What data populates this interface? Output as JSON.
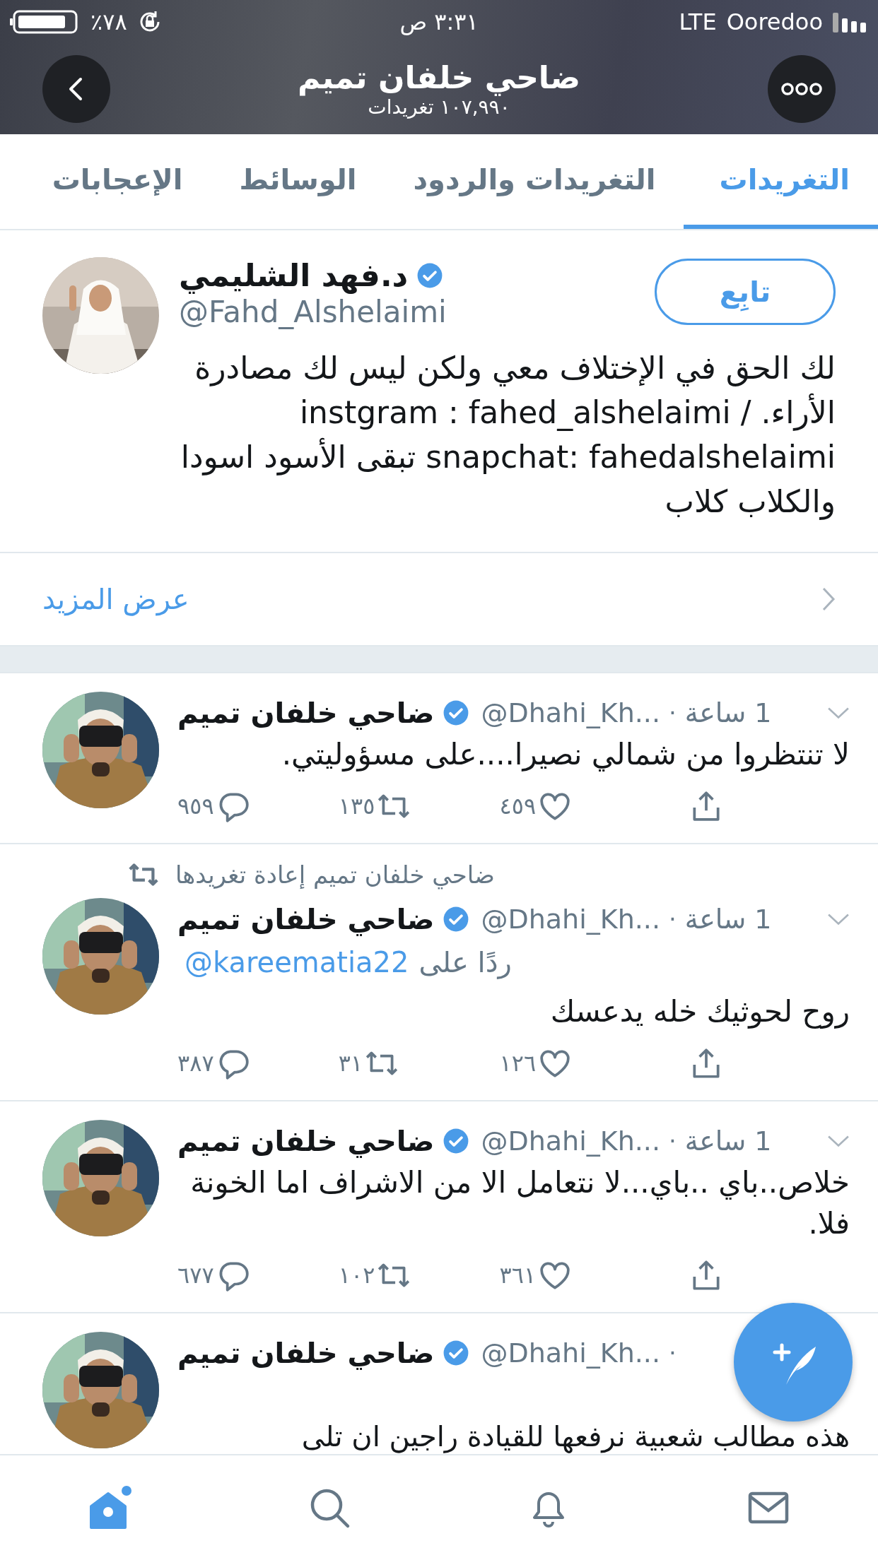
{
  "status_bar": {
    "battery": "٪٧٨",
    "time": "٣:٣١ ص",
    "network": "LTE",
    "carrier": "Ooredoo"
  },
  "header": {
    "title": "ضاحي خلفان تميم",
    "subtitle": "١٠٧,٩٩٠ تغريدات"
  },
  "tabs": [
    {
      "label": "التغريدات",
      "selected": true
    },
    {
      "label": "التغريدات والردود",
      "selected": false
    },
    {
      "label": "الوسائط",
      "selected": false
    },
    {
      "label": "الإعجابات",
      "selected": false
    }
  ],
  "profile_card": {
    "name": "د.فهد الشليمي",
    "verified": true,
    "handle": "@Fahd_Alshelaimi",
    "follow_button": "تابِع",
    "bio": "لك الحق في الإختلاف معي ولكن ليس لك مصادرة الأراء. / instgram : fahed_alshelaimi snapchat: fahedalshelaimi تبقى الأسود اسودا والكلاب كلاب"
  },
  "show_more": "عرض المزيد",
  "tweets": [
    {
      "name": "ضاحي خلفان تميم",
      "verified": true,
      "handle": "@Dhahi_Kh...",
      "sep": "·",
      "time": "1 ساعة",
      "text": "لا تنتظروا من شمالي نصيرا....على مسؤوليتي.",
      "replies": "٩٥٩",
      "retweets": "١٣٥",
      "likes": "٤٥٩"
    },
    {
      "retweeted_by": "ضاحي خلفان تميم إعادة تغريدها",
      "name": "ضاحي خلفان تميم",
      "verified": true,
      "handle": "@Dhahi_Kh...",
      "sep": "·",
      "time": "1 ساعة",
      "reply_to": {
        "prefix": "ردًا على",
        "handle": "@kareematia22"
      },
      "text": "روح لحوثيك خله يدعسك",
      "replies": "٣٨٧",
      "retweets": "٣١",
      "likes": "١٢٦"
    },
    {
      "name": "ضاحي خلفان تميم",
      "verified": true,
      "handle": "@Dhahi_Kh...",
      "sep": "·",
      "time": "1 ساعة",
      "text": "خلاص..باي ..باي...لا نتعامل الا من الاشراف اما الخونة فلا.",
      "replies": "٦٧٧",
      "retweets": "١٠٢",
      "likes": "٣٦١"
    },
    {
      "name": "ضاحي خلفان تميم",
      "verified": true,
      "handle": "@Dhahi_Kh...",
      "sep": "·",
      "text": "هذه مطالب شعبية نرفعها للقيادة راجين ان تلى"
    }
  ],
  "bottom_nav": [
    {
      "selected": true
    },
    {
      "selected": false
    },
    {
      "selected": false
    },
    {
      "selected": false
    }
  ]
}
